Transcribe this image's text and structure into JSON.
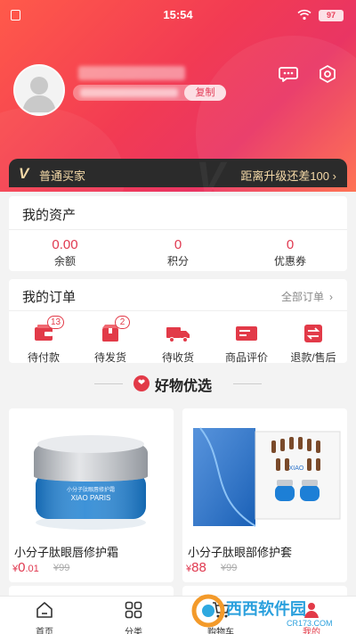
{
  "status_bar": {
    "time": "15:54",
    "battery": "97"
  },
  "profile": {
    "copy_label": "复制"
  },
  "member": {
    "level": "普通买家",
    "upgrade_text": "距离升级还差100",
    "upgrade_arrow": "›"
  },
  "assets": {
    "title": "我的资产",
    "items": [
      {
        "value": "0.00",
        "label": "余额"
      },
      {
        "value": "0",
        "label": "积分"
      },
      {
        "value": "0",
        "label": "优惠券"
      }
    ]
  },
  "orders": {
    "title": "我的订单",
    "all_label": "全部订单",
    "items": [
      {
        "label": "待付款",
        "badge": "13",
        "icon": "wallet-icon"
      },
      {
        "label": "待发货",
        "badge": "2",
        "icon": "box-icon"
      },
      {
        "label": "待收货",
        "badge": "",
        "icon": "truck-icon"
      },
      {
        "label": "商品评价",
        "badge": "",
        "icon": "comment-icon"
      },
      {
        "label": "退款/售后",
        "badge": "",
        "icon": "refund-icon"
      }
    ]
  },
  "featured": {
    "title": "好物优选"
  },
  "products": [
    {
      "name": "小分子肽眼唇修护霜",
      "currency": "¥",
      "price_int": "0",
      "price_dec": ".01",
      "old_price": "¥99",
      "jar_text": "XIAO PARIS"
    },
    {
      "name": "小分子肽眼部修护套",
      "currency": "¥",
      "price_int": "88",
      "price_dec": "",
      "old_price": "¥99",
      "box_text": "XIAO"
    }
  ],
  "tabbar": [
    {
      "label": "首页",
      "icon": "home-icon"
    },
    {
      "label": "分类",
      "icon": "category-icon"
    },
    {
      "label": "购物车",
      "icon": "cart-icon"
    },
    {
      "label": "我的",
      "icon": "user-icon"
    }
  ],
  "watermark": {
    "brand": "西西软件园",
    "url": "CR173.COM"
  },
  "colors": {
    "accent": "#e0384f",
    "hero_start": "#ff5a4a",
    "hero_end": "#e93563",
    "member_bar": "#2b2b2b",
    "member_text": "#f4d9a7"
  }
}
